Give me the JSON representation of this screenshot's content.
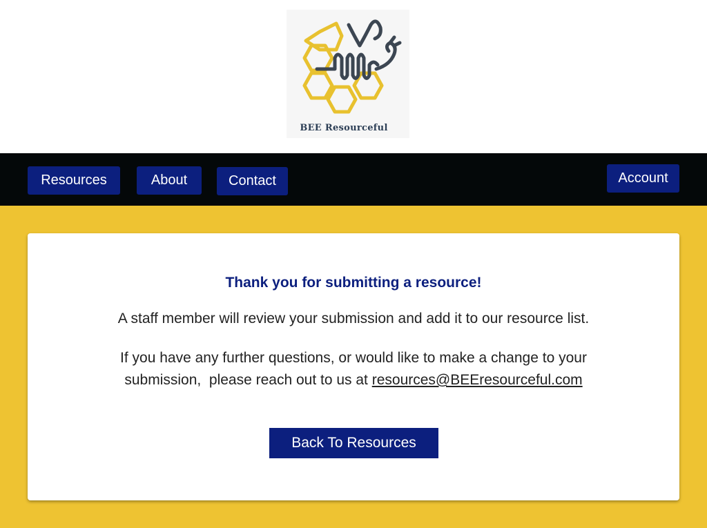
{
  "brand": {
    "logo_text": "BEE Resourceful",
    "colors": {
      "honeycomb": "#e8c12f",
      "bee": "#3c4652"
    }
  },
  "nav": {
    "items": [
      {
        "label": "Resources"
      },
      {
        "label": "About"
      },
      {
        "label": "Contact"
      }
    ],
    "account_label": "Account",
    "colors": {
      "bar_bg": "#040809",
      "button_bg": "#0c1f7e",
      "button_text": "#ffffff"
    }
  },
  "page": {
    "background": "#eec332"
  },
  "confirmation": {
    "title": "Thank you for submitting a resource!",
    "line1": "A staff member will review your submission and add it to our resource list.",
    "line2a": "If you have any further questions, or would like to make a change to your",
    "line2b": "submission,  please reach out to us at ",
    "email": "resources@BEEresourceful.com",
    "back_button_label": "Back To Resources"
  }
}
